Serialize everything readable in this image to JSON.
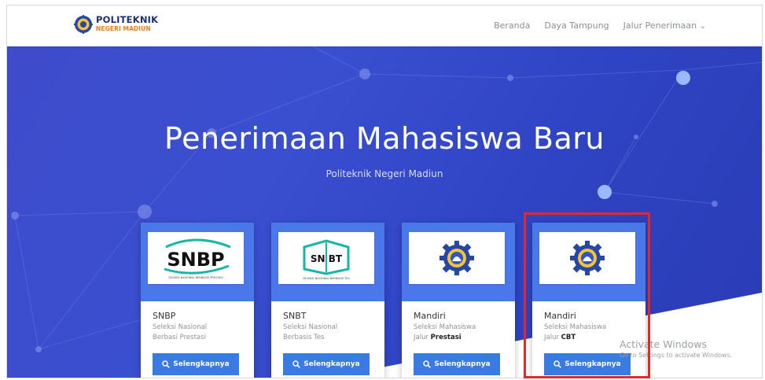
{
  "header": {
    "logo_line1": "POLITEKNIK",
    "logo_line2": "NEGERI MADIUN",
    "nav_items": [
      "Beranda",
      "Daya Tampung",
      "Jalur Penerimaan"
    ],
    "dropdown_caret": "⌄"
  },
  "hero": {
    "title": "Penerimaan Mahasiswa Baru",
    "subtitle": "Politeknik Negeri Madiun"
  },
  "cards": [
    {
      "title": "SNBP",
      "desc_line1": "Seleksi Nasional",
      "desc_line2_prefix": "Berbasi Prestasi",
      "desc_line2_bold": "",
      "button": "Selengkapnya",
      "logo": "SNBP",
      "logo_caption": "SELEKSI NASIONAL BERBASIS PRESTASI"
    },
    {
      "title": "SNBT",
      "desc_line1": "Seleksi Nasional",
      "desc_line2_prefix": "Berbasis Tes",
      "desc_line2_bold": "",
      "button": "Selengkapnya",
      "logo": "SN BT",
      "logo_caption": "SELEKSI NASIONAL BERBASIS TES"
    },
    {
      "title": "Mandiri",
      "desc_line1": "Seleksi Mahasiswa",
      "desc_line2_prefix": "Jalur ",
      "desc_line2_bold": "Prestasi",
      "button": "Selengkapnya",
      "logo": "seal",
      "logo_caption": ""
    },
    {
      "title": "Mandiri",
      "desc_line1": "Seleksi Mahasiswa",
      "desc_line2_prefix": "Jalur ",
      "desc_line2_bold": "CBT",
      "button": "Selengkapnya",
      "logo": "seal",
      "logo_caption": ""
    }
  ],
  "watermark": {
    "line1": "Activate Windows",
    "line2": "Go to Settings to activate Windows."
  },
  "colors": {
    "hero_blue": "#3a4fd0",
    "card_top_blue": "#4a78e8",
    "button_blue": "#3a7be3",
    "highlight_red": "#e02a2a",
    "logo_orange": "#f07d1a"
  },
  "icons": {
    "search": "search-icon",
    "caret": "chevron-down-icon"
  }
}
